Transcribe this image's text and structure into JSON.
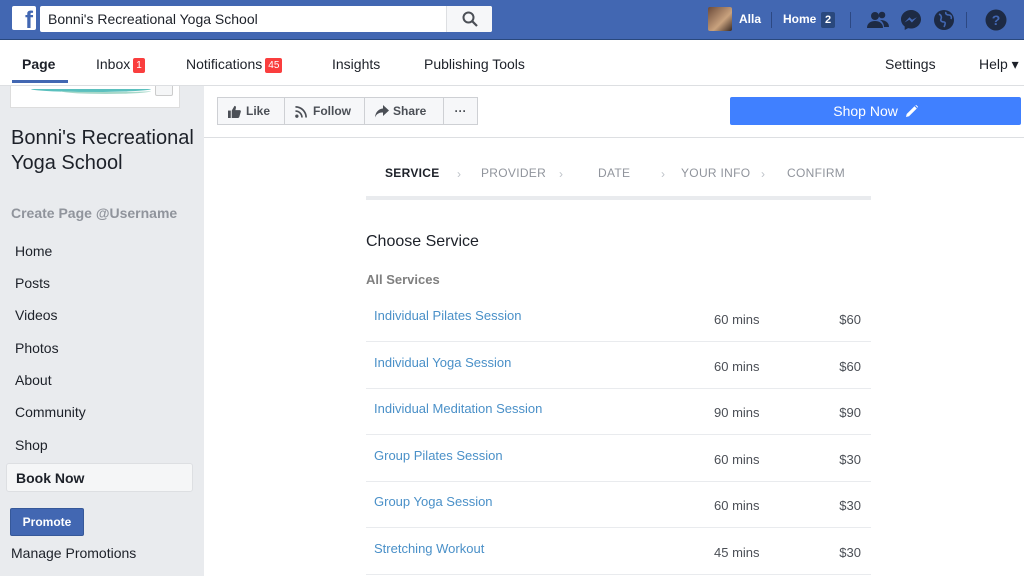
{
  "topbar": {
    "search_value": "Bonni's Recreational Yoga School",
    "user_name": "Alla",
    "home_label": "Home",
    "home_count": "2"
  },
  "tabs": {
    "page": "Page",
    "inbox": "Inbox",
    "inbox_count": "1",
    "notifications": "Notifications",
    "notifications_count": "45",
    "insights": "Insights",
    "publishing_tools": "Publishing Tools",
    "settings": "Settings",
    "help": "Help ▾"
  },
  "sidebar": {
    "page_name": "Bonni's Recreational Yoga School",
    "username": "Create Page @Username",
    "items": [
      {
        "label": "Home"
      },
      {
        "label": "Posts"
      },
      {
        "label": "Videos"
      },
      {
        "label": "Photos"
      },
      {
        "label": "About"
      },
      {
        "label": "Community"
      },
      {
        "label": "Shop"
      },
      {
        "label": "Book Now"
      }
    ],
    "promote_label": "Promote",
    "manage_promotions": "Manage Promotions"
  },
  "actions": {
    "like": "Like",
    "follow": "Follow",
    "share": "Share",
    "more": "···",
    "shop_now": "Shop Now"
  },
  "booking": {
    "steps": [
      "SERVICE",
      "PROVIDER",
      "DATE",
      "YOUR INFO",
      "CONFIRM"
    ],
    "title": "Choose Service",
    "subtitle": "All Services",
    "services": [
      {
        "name": "Individual Pilates Session",
        "duration": "60 mins",
        "price": "$60"
      },
      {
        "name": "Individual Yoga Session",
        "duration": "60 mins",
        "price": "$60"
      },
      {
        "name": "Individual Meditation Session",
        "duration": "90 mins",
        "price": "$90"
      },
      {
        "name": "Group Pilates Session",
        "duration": "60 mins",
        "price": "$30"
      },
      {
        "name": "Group Yoga Session",
        "duration": "60 mins",
        "price": "$30"
      },
      {
        "name": "Stretching Workout",
        "duration": "45 mins",
        "price": "$30"
      }
    ]
  },
  "colors": {
    "brand_blue": "#4267b2",
    "shop_button": "#4080ff",
    "link": "#4a90c8",
    "badge_red": "#fa3e3e"
  },
  "icons": {
    "logo": "facebook-logo-icon",
    "search": "search-icon",
    "friends": "friend-requests-icon",
    "messenger": "messenger-icon",
    "globe": "notifications-globe-icon",
    "help": "help-question-icon",
    "like": "thumbs-up-icon",
    "follow": "rss-follow-icon",
    "share": "share-arrow-icon",
    "pencil": "pencil-icon"
  }
}
